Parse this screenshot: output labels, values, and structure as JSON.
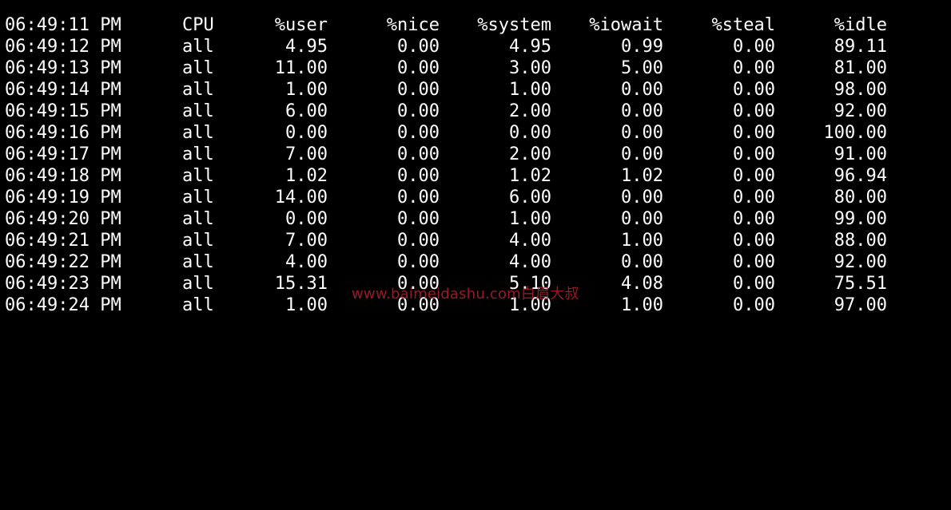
{
  "header": {
    "time": "06:49:11 PM",
    "cpu": "CPU",
    "user": "%user",
    "nice": "%nice",
    "system": "%system",
    "iowait": "%iowait",
    "steal": "%steal",
    "idle": "%idle"
  },
  "rows": [
    {
      "time": "06:49:12 PM",
      "cpu": "all",
      "user": "4.95",
      "nice": "0.00",
      "system": "4.95",
      "iowait": "0.99",
      "steal": "0.00",
      "idle": "89.11"
    },
    {
      "time": "06:49:13 PM",
      "cpu": "all",
      "user": "11.00",
      "nice": "0.00",
      "system": "3.00",
      "iowait": "5.00",
      "steal": "0.00",
      "idle": "81.00"
    },
    {
      "time": "06:49:14 PM",
      "cpu": "all",
      "user": "1.00",
      "nice": "0.00",
      "system": "1.00",
      "iowait": "0.00",
      "steal": "0.00",
      "idle": "98.00"
    },
    {
      "time": "06:49:15 PM",
      "cpu": "all",
      "user": "6.00",
      "nice": "0.00",
      "system": "2.00",
      "iowait": "0.00",
      "steal": "0.00",
      "idle": "92.00"
    },
    {
      "time": "06:49:16 PM",
      "cpu": "all",
      "user": "0.00",
      "nice": "0.00",
      "system": "0.00",
      "iowait": "0.00",
      "steal": "0.00",
      "idle": "100.00"
    },
    {
      "time": "06:49:17 PM",
      "cpu": "all",
      "user": "7.00",
      "nice": "0.00",
      "system": "2.00",
      "iowait": "0.00",
      "steal": "0.00",
      "idle": "91.00"
    },
    {
      "time": "06:49:18 PM",
      "cpu": "all",
      "user": "1.02",
      "nice": "0.00",
      "system": "1.02",
      "iowait": "1.02",
      "steal": "0.00",
      "idle": "96.94"
    },
    {
      "time": "06:49:19 PM",
      "cpu": "all",
      "user": "14.00",
      "nice": "0.00",
      "system": "6.00",
      "iowait": "0.00",
      "steal": "0.00",
      "idle": "80.00"
    },
    {
      "time": "06:49:20 PM",
      "cpu": "all",
      "user": "0.00",
      "nice": "0.00",
      "system": "1.00",
      "iowait": "0.00",
      "steal": "0.00",
      "idle": "99.00"
    },
    {
      "time": "06:49:21 PM",
      "cpu": "all",
      "user": "7.00",
      "nice": "0.00",
      "system": "4.00",
      "iowait": "1.00",
      "steal": "0.00",
      "idle": "88.00"
    },
    {
      "time": "06:49:22 PM",
      "cpu": "all",
      "user": "4.00",
      "nice": "0.00",
      "system": "4.00",
      "iowait": "0.00",
      "steal": "0.00",
      "idle": "92.00"
    },
    {
      "time": "06:49:23 PM",
      "cpu": "all",
      "user": "15.31",
      "nice": "0.00",
      "system": "5.10",
      "iowait": "4.08",
      "steal": "0.00",
      "idle": "75.51"
    },
    {
      "time": "06:49:24 PM",
      "cpu": "all",
      "user": "1.00",
      "nice": "0.00",
      "system": "1.00",
      "iowait": "1.00",
      "steal": "0.00",
      "idle": "97.00"
    }
  ],
  "watermark": "www.baimeidashu.com白眉大叔",
  "colors": {
    "background": "#000000",
    "text": "#ffffff",
    "watermark": "#b3202a"
  }
}
